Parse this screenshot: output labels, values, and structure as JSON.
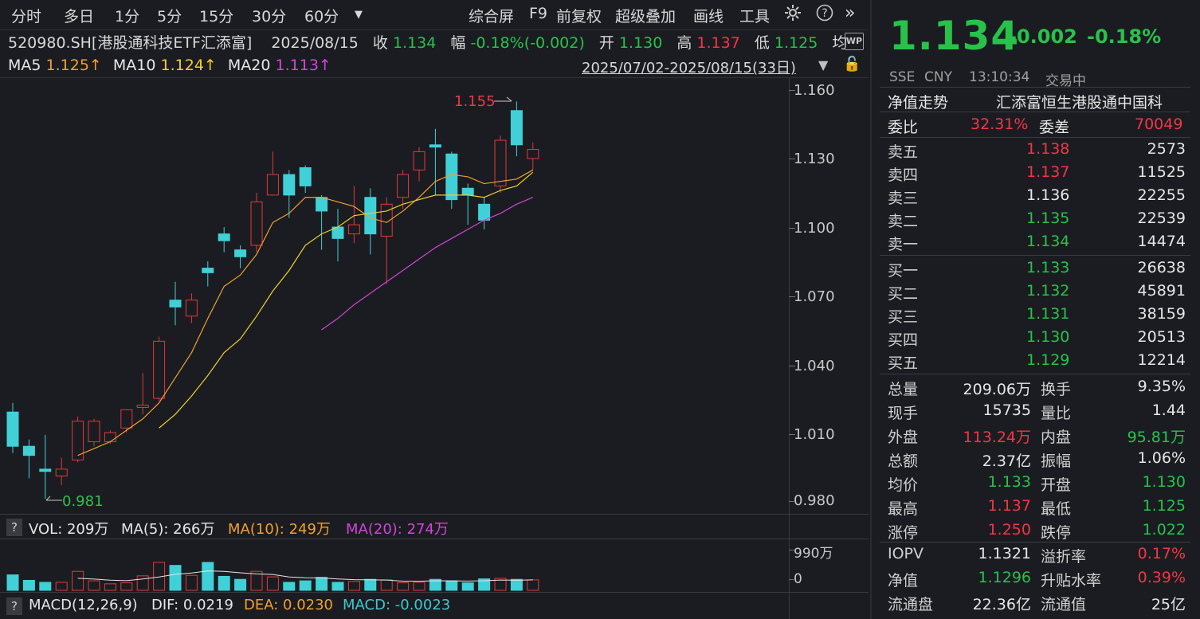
{
  "toolbar": {
    "periods": [
      "分时",
      "多日",
      "1分",
      "5分",
      "15分",
      "30分",
      "60分"
    ],
    "more_icon": "dropdown-triangle-icon",
    "tools": [
      "综合屏",
      "F9",
      "前复权",
      "超级叠加",
      "画线",
      "工具"
    ],
    "settings_icon": "gear-icon",
    "help_icon": "question-icon",
    "expand_icon": "double-chevron-right-icon"
  },
  "info": {
    "code_name": "520980.SH[港股通科技ETF汇添富]",
    "date": "2025/08/15",
    "close_label": "收",
    "close": "1.134",
    "change_label": "幅",
    "change": "-0.18%(-0.002)",
    "open_label": "开",
    "open": "1.130",
    "high_label": "高",
    "high": "1.137",
    "low_label": "低",
    "low": "1.125",
    "avg_label": "均"
  },
  "ma": {
    "ma5_label": "MA5",
    "ma5": "1.125↑",
    "ma10_label": "MA10",
    "ma10": "1.124↑",
    "ma20_label": "MA20",
    "ma20": "1.113↑"
  },
  "range": "2025/07/02-2025/08/15(33日)",
  "price_axis": [
    "1.160",
    "1.130",
    "1.100",
    "1.070",
    "1.040",
    "1.010",
    "0.980"
  ],
  "annotations": {
    "max": "1.155",
    "min": "0.981"
  },
  "volume_bar": {
    "help": "?",
    "vol": "VOL: 209万",
    "ma5": "MA(5): 266万",
    "ma10": "MA(10): 249万",
    "ma20": "MA(20): 274万",
    "axis_top": "990万",
    "axis_bottom": "0"
  },
  "macd_bar": {
    "help": "?",
    "title": "MACD(12,26,9)",
    "dif": "DIF: 0.0219",
    "dea": "DEA: 0.0230",
    "macd": "MACD: -0.0023"
  },
  "chart_data": {
    "type": "candlestick",
    "ylim": [
      0.975,
      1.165
    ],
    "candles": [
      {
        "o": 1.019,
        "c": 1.004,
        "h": 1.023,
        "l": 1.001
      },
      {
        "o": 1.004,
        "c": 1.0,
        "h": 1.007,
        "l": 0.99
      },
      {
        "o": 0.994,
        "c": 0.993,
        "h": 1.009,
        "l": 0.981
      },
      {
        "o": 0.991,
        "c": 0.994,
        "h": 0.999,
        "l": 0.987
      },
      {
        "o": 0.998,
        "c": 1.015,
        "h": 1.017,
        "l": 0.997
      },
      {
        "o": 1.006,
        "c": 1.015,
        "h": 1.016,
        "l": 1.004
      },
      {
        "o": 1.006,
        "c": 1.01,
        "h": 1.011,
        "l": 1.005
      },
      {
        "o": 1.012,
        "c": 1.02,
        "h": 1.02,
        "l": 1.01
      },
      {
        "o": 1.021,
        "c": 1.022,
        "h": 1.036,
        "l": 1.018
      },
      {
        "o": 1.025,
        "c": 1.05,
        "h": 1.052,
        "l": 1.024
      },
      {
        "o": 1.068,
        "c": 1.065,
        "h": 1.076,
        "l": 1.057
      },
      {
        "o": 1.061,
        "c": 1.068,
        "h": 1.071,
        "l": 1.058
      },
      {
        "o": 1.082,
        "c": 1.08,
        "h": 1.085,
        "l": 1.074
      },
      {
        "o": 1.097,
        "c": 1.094,
        "h": 1.1,
        "l": 1.089
      },
      {
        "o": 1.09,
        "c": 1.087,
        "h": 1.092,
        "l": 1.082
      },
      {
        "o": 1.092,
        "c": 1.111,
        "h": 1.115,
        "l": 1.089
      },
      {
        "o": 1.114,
        "c": 1.123,
        "h": 1.133,
        "l": 1.114
      },
      {
        "o": 1.123,
        "c": 1.114,
        "h": 1.125,
        "l": 1.104
      },
      {
        "o": 1.126,
        "c": 1.118,
        "h": 1.127,
        "l": 1.115
      },
      {
        "o": 1.113,
        "c": 1.107,
        "h": 1.114,
        "l": 1.09
      },
      {
        "o": 1.1,
        "c": 1.095,
        "h": 1.108,
        "l": 1.085
      },
      {
        "o": 1.097,
        "c": 1.101,
        "h": 1.118,
        "l": 1.093
      },
      {
        "o": 1.113,
        "c": 1.097,
        "h": 1.117,
        "l": 1.088
      },
      {
        "o": 1.096,
        "c": 1.11,
        "h": 1.113,
        "l": 1.075
      },
      {
        "o": 1.113,
        "c": 1.123,
        "h": 1.125,
        "l": 1.108
      },
      {
        "o": 1.125,
        "c": 1.133,
        "h": 1.135,
        "l": 1.12
      },
      {
        "o": 1.136,
        "c": 1.135,
        "h": 1.143,
        "l": 1.114
      },
      {
        "o": 1.132,
        "c": 1.112,
        "h": 1.133,
        "l": 1.108
      },
      {
        "o": 1.117,
        "c": 1.114,
        "h": 1.119,
        "l": 1.101
      },
      {
        "o": 1.11,
        "c": 1.103,
        "h": 1.113,
        "l": 1.099
      },
      {
        "o": 1.118,
        "c": 1.138,
        "h": 1.14,
        "l": 1.115
      },
      {
        "o": 1.151,
        "c": 1.136,
        "h": 1.155,
        "l": 1.131
      },
      {
        "o": 1.13,
        "c": 1.134,
        "h": 1.137,
        "l": 1.125
      }
    ],
    "ma5": [
      null,
      null,
      null,
      null,
      1.0,
      1.003,
      1.006,
      1.011,
      1.016,
      1.023,
      1.034,
      1.045,
      1.06,
      1.074,
      1.079,
      1.088,
      1.102,
      1.106,
      1.113,
      1.113,
      1.111,
      1.109,
      1.104,
      1.102,
      1.107,
      1.113,
      1.12,
      1.123,
      1.122,
      1.119,
      1.12,
      1.121,
      1.125
    ],
    "ma10": [
      null,
      null,
      null,
      null,
      null,
      null,
      null,
      null,
      null,
      1.012,
      1.018,
      1.026,
      1.035,
      1.045,
      1.051,
      1.061,
      1.072,
      1.081,
      1.092,
      1.097,
      1.1,
      1.105,
      1.106,
      1.107,
      1.11,
      1.112,
      1.114,
      1.114,
      1.114,
      1.113,
      1.116,
      1.118,
      1.124
    ],
    "ma20": [
      null,
      null,
      null,
      null,
      null,
      null,
      null,
      null,
      null,
      null,
      null,
      null,
      null,
      null,
      null,
      null,
      null,
      null,
      null,
      1.055,
      1.06,
      1.066,
      1.071,
      1.076,
      1.081,
      1.086,
      1.091,
      1.095,
      1.099,
      1.103,
      1.106,
      1.11,
      1.113
    ],
    "volume": [
      310,
      200,
      160,
      160,
      380,
      190,
      130,
      150,
      290,
      560,
      500,
      300,
      560,
      280,
      220,
      380,
      270,
      160,
      190,
      260,
      160,
      180,
      220,
      210,
      150,
      160,
      220,
      190,
      150,
      230,
      240,
      220,
      209
    ],
    "volume_max": 990,
    "vol_ma_line": [
      null,
      null,
      null,
      null,
      242,
      226,
      204,
      194,
      228,
      268,
      322,
      348,
      390,
      380,
      352,
      330,
      318,
      268,
      252,
      248,
      228,
      214,
      210,
      206,
      184,
      182,
      192,
      190,
      186,
      192,
      206,
      202,
      209
    ]
  },
  "panel": {
    "price": "1.134",
    "change": "-0.002",
    "change_pct": "-0.18%",
    "exchange": "SSE",
    "currency": "CNY",
    "time": "13:10:34",
    "status": "交易中",
    "nav_trend": "净值走势",
    "fund_name": "汇添富恒生港股通中国科",
    "ratio_label": "委比",
    "ratio": "32.31%",
    "diff_label": "委差",
    "diff": "70049",
    "asks": [
      {
        "label": "卖五",
        "price": "1.138",
        "vol": "2573",
        "color": "#f23645"
      },
      {
        "label": "卖四",
        "price": "1.137",
        "vol": "11525",
        "color": "#f23645"
      },
      {
        "label": "卖三",
        "price": "1.136",
        "vol": "22255",
        "color": "#e6e6e6"
      },
      {
        "label": "卖二",
        "price": "1.135",
        "vol": "22539",
        "color": "#28c24b"
      },
      {
        "label": "卖一",
        "price": "1.134",
        "vol": "14474",
        "color": "#28c24b"
      }
    ],
    "bids": [
      {
        "label": "买一",
        "price": "1.133",
        "vol": "26638",
        "color": "#28c24b"
      },
      {
        "label": "买二",
        "price": "1.132",
        "vol": "45891",
        "color": "#28c24b"
      },
      {
        "label": "买三",
        "price": "1.131",
        "vol": "38159",
        "color": "#28c24b"
      },
      {
        "label": "买四",
        "price": "1.130",
        "vol": "20513",
        "color": "#28c24b"
      },
      {
        "label": "买五",
        "price": "1.129",
        "vol": "12214",
        "color": "#28c24b"
      }
    ],
    "stats": [
      {
        "l1": "总量",
        "v1": "209.06万",
        "c1": "#e6e6e6",
        "l2": "换手",
        "v2": "9.35%",
        "c2": "#e6e6e6"
      },
      {
        "l1": "现手",
        "v1": "15735",
        "c1": "#e6e6e6",
        "l2": "量比",
        "v2": "1.44",
        "c2": "#e6e6e6"
      },
      {
        "l1": "外盘",
        "v1": "113.24万",
        "c1": "#f23645",
        "l2": "内盘",
        "v2": "95.81万",
        "c2": "#28c24b"
      },
      {
        "l1": "总额",
        "v1": "2.37亿",
        "c1": "#e6e6e6",
        "l2": "振幅",
        "v2": "1.06%",
        "c2": "#e6e6e6"
      },
      {
        "l1": "均价",
        "v1": "1.133",
        "c1": "#28c24b",
        "l2": "开盘",
        "v2": "1.130",
        "c2": "#28c24b"
      },
      {
        "l1": "最高",
        "v1": "1.137",
        "c1": "#f23645",
        "l2": "最低",
        "v2": "1.125",
        "c2": "#28c24b"
      },
      {
        "l1": "涨停",
        "v1": "1.250",
        "c1": "#f23645",
        "l2": "跌停",
        "v2": "1.022",
        "c2": "#28c24b"
      }
    ],
    "stats2": [
      {
        "l1": "IOPV",
        "v1": "1.1321",
        "c1": "#e6e6e6",
        "l2": "溢折率",
        "v2": "0.17%",
        "c2": "#f23645"
      },
      {
        "l1": "净值",
        "v1": "1.1296",
        "c1": "#28c24b",
        "l2": "升贴水率",
        "v2": "0.39%",
        "c2": "#f23645"
      },
      {
        "l1": "流通盘",
        "v1": "22.36亿",
        "c1": "#e6e6e6",
        "l2": "流通值",
        "v2": "25亿",
        "c2": "#e6e6e6"
      }
    ]
  }
}
